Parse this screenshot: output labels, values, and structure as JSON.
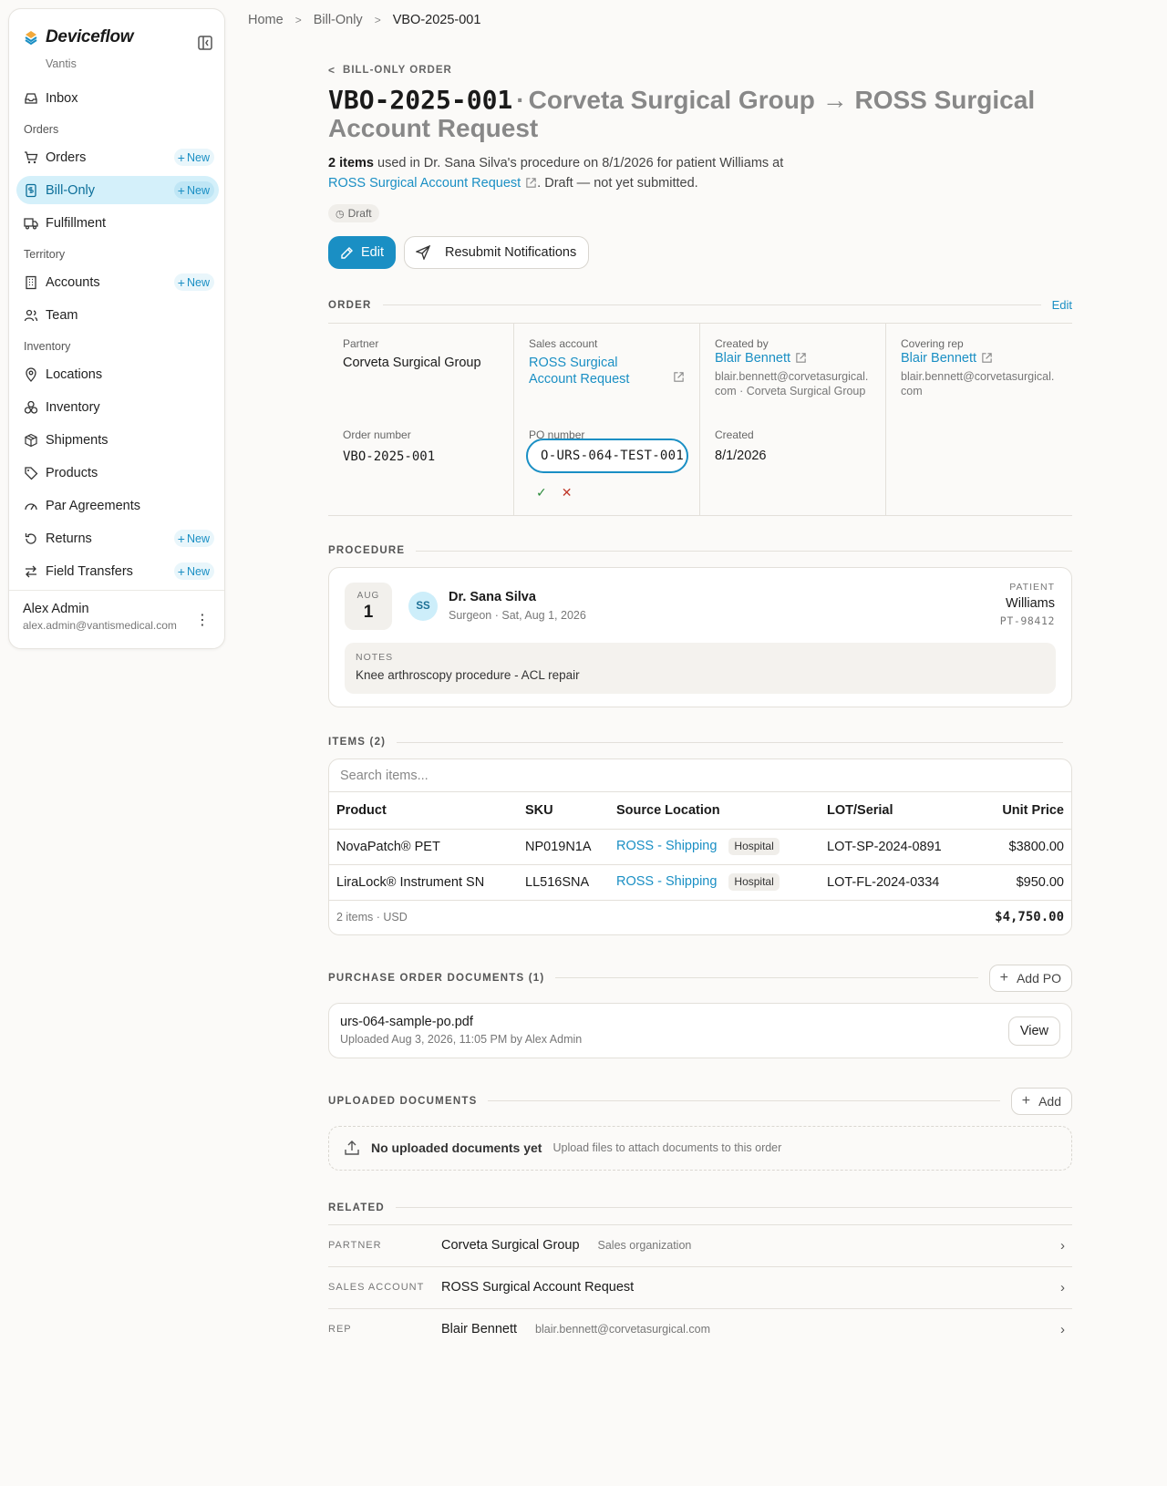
{
  "app": {
    "name": "Deviceflow",
    "org": "Vantis"
  },
  "nav": {
    "inbox": "Inbox",
    "sections": {
      "orders": "Orders",
      "territory": "Territory",
      "inventory": "Inventory"
    },
    "new_label": "New",
    "items": {
      "orders": "Orders",
      "bill_only": "Bill-Only",
      "fulfillment": "Fulfillment",
      "accounts": "Accounts",
      "team": "Team",
      "locations": "Locations",
      "inventory": "Inventory",
      "shipments": "Shipments",
      "products": "Products",
      "par_agreements": "Par Agreements",
      "returns": "Returns",
      "field_transfers": "Field Transfers"
    }
  },
  "user": {
    "name": "Alex Admin",
    "email": "alex.admin@vantismedical.com"
  },
  "breadcrumb": {
    "home": "Home",
    "section": "Bill-Only",
    "current": "VBO-2025-001"
  },
  "header": {
    "back_label": "BILL-ONLY ORDER",
    "code": "VBO-2025-001",
    "from": "Corveta Surgical Group",
    "arrow": "→",
    "to": "ROSS Surgical Account Request",
    "summary_count": "2 items",
    "summary_mid": "used in Dr. Sana Silva's procedure on 8/1/2026 for patient Williams at",
    "summary_link": "ROSS Surgical Account Request",
    "summary_tail": ". Draft — not yet submitted.",
    "status": "Draft"
  },
  "actions": {
    "edit": "Edit",
    "resubmit": "Resubmit Notifications"
  },
  "order": {
    "section_label": "ORDER",
    "edit_link": "Edit",
    "partner_label": "Partner",
    "partner": "Corveta Surgical Group",
    "sales_account_label": "Sales account",
    "sales_account": "ROSS Surgical Account Request",
    "created_by_label": "Created by",
    "created_by": "Blair Bennett",
    "created_by_sub": "blair.bennett@corvetasurgical.com · Corveta Surgical Group",
    "covering_rep_label": "Covering rep",
    "covering_rep": "Blair Bennett",
    "covering_rep_sub": "blair.bennett@corvetasurgical.com",
    "order_number_label": "Order number",
    "order_number": "VBO-2025-001",
    "po_number_label": "PO number",
    "po_number_value": "O-URS-064-TEST-001",
    "created_label": "Created",
    "created": "8/1/2026"
  },
  "procedure": {
    "section_label": "PROCEDURE",
    "month": "AUG",
    "day": "1",
    "initials": "SS",
    "surgeon": "Dr. Sana Silva",
    "surgeon_sub": "Surgeon · Sat, Aug 1, 2026",
    "patient_label": "PATIENT",
    "patient": "Williams",
    "patient_id": "PT-98412",
    "notes_label": "NOTES",
    "notes": "Knee arthroscopy procedure - ACL repair"
  },
  "items": {
    "section_label": "ITEMS (2)",
    "search_placeholder": "Search items...",
    "columns": {
      "product": "Product",
      "sku": "SKU",
      "location": "Source Location",
      "lot": "LOT/Serial",
      "price": "Unit Price"
    },
    "rows": [
      {
        "product": "NovaPatch® PET",
        "sku": "NP019N1A",
        "location": "ROSS - Shipping",
        "tag": "Hospital",
        "lot": "LOT-SP-2024-0891",
        "price": "$3800.00"
      },
      {
        "product": "LiraLock® Instrument SN",
        "sku": "LL516SNA",
        "location": "ROSS - Shipping",
        "tag": "Hospital",
        "lot": "LOT-FL-2024-0334",
        "price": "$950.00"
      }
    ],
    "footer_count": "2 items · USD",
    "footer_total": "$4,750.00"
  },
  "po_docs": {
    "section_label": "PURCHASE ORDER DOCUMENTS (1)",
    "add_label": "Add PO",
    "file_name": "urs-064-sample-po.pdf",
    "file_sub": "Uploaded Aug 3, 2026, 11:05 PM by Alex Admin",
    "view_label": "View"
  },
  "uploads": {
    "section_label": "UPLOADED DOCUMENTS",
    "add_label": "Add",
    "empty_title": "No uploaded documents yet",
    "empty_sub": "Upload files to attach documents to this order"
  },
  "related": {
    "section_label": "RELATED",
    "rows": [
      {
        "label": "PARTNER",
        "value": "Corveta Surgical Group",
        "sub": "Sales organization"
      },
      {
        "label": "SALES ACCOUNT",
        "value": "ROSS Surgical Account Request",
        "sub": ""
      },
      {
        "label": "REP",
        "value": "Blair Bennett",
        "sub": "blair.bennett@corvetasurgical.com"
      }
    ]
  }
}
